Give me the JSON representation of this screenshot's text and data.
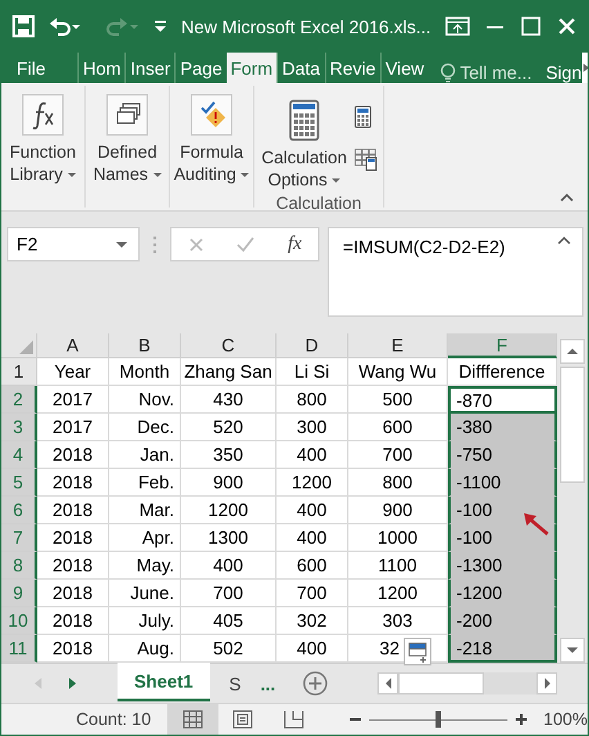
{
  "window": {
    "title": "New Microsoft Excel 2016.xls..."
  },
  "tabs": [
    {
      "label": "File",
      "selected": false
    },
    {
      "label": "Hom",
      "selected": false
    },
    {
      "label": "Inser",
      "selected": false
    },
    {
      "label": "Page",
      "selected": false
    },
    {
      "label": "Form",
      "selected": true
    },
    {
      "label": "Data",
      "selected": false
    },
    {
      "label": "Revie",
      "selected": false
    },
    {
      "label": "View",
      "selected": false
    }
  ],
  "tell_me": "Tell me...",
  "sign_in": "Sign",
  "ribbon": {
    "groups": [
      {
        "buttons": [
          {
            "kind": "fx",
            "label": "Function Library"
          }
        ]
      },
      {
        "buttons": [
          {
            "kind": "names",
            "label": "Defined Names"
          }
        ]
      },
      {
        "buttons": [
          {
            "kind": "audit",
            "label": "Formula Auditing"
          }
        ]
      },
      {
        "label": "Calculation",
        "buttons": [
          {
            "kind": "calc",
            "label": "Calculation Options"
          }
        ]
      }
    ]
  },
  "formula_bar": {
    "name_box": "F2",
    "fx": "fx",
    "formula": "=IMSUM(C2-D2-E2)"
  },
  "sheet": {
    "columns": [
      {
        "label": "A",
        "selected": false
      },
      {
        "label": "B",
        "selected": false
      },
      {
        "label": "C",
        "selected": false
      },
      {
        "label": "D",
        "selected": false
      },
      {
        "label": "E",
        "selected": false
      },
      {
        "label": "F",
        "selected": true
      }
    ],
    "rows": [
      {
        "number": "1",
        "selected": false,
        "cells": [
          "Year",
          "Month",
          "Zhang San",
          "Li Si",
          "Wang Wu",
          "Diffference"
        ]
      },
      {
        "number": "2",
        "selected": true,
        "cells": [
          "2017",
          "Nov.",
          "430",
          "800",
          "500",
          "-870"
        ]
      },
      {
        "number": "3",
        "selected": true,
        "cells": [
          "2017",
          "Dec.",
          "520",
          "300",
          "600",
          "-380"
        ]
      },
      {
        "number": "4",
        "selected": true,
        "cells": [
          "2018",
          "Jan.",
          "350",
          "400",
          "700",
          "-750"
        ]
      },
      {
        "number": "5",
        "selected": true,
        "cells": [
          "2018",
          "Feb.",
          "900",
          "1200",
          "800",
          "-1100"
        ]
      },
      {
        "number": "6",
        "selected": true,
        "cells": [
          "2018",
          "Mar.",
          "1200",
          "400",
          "900",
          "-100"
        ]
      },
      {
        "number": "7",
        "selected": true,
        "cells": [
          "2018",
          "Apr.",
          "1300",
          "400",
          "1000",
          "-100"
        ]
      },
      {
        "number": "8",
        "selected": true,
        "cells": [
          "2018",
          "May.",
          "400",
          "600",
          "1100",
          "-1300"
        ]
      },
      {
        "number": "9",
        "selected": true,
        "cells": [
          "2018",
          "June.",
          "700",
          "700",
          "1200",
          "-1200"
        ]
      },
      {
        "number": "10",
        "selected": true,
        "cells": [
          "2018",
          "July.",
          "405",
          "302",
          "303",
          "-200"
        ]
      },
      {
        "number": "11",
        "selected": true,
        "cells": [
          "2018",
          "Aug.",
          "502",
          "400",
          "32",
          "-218"
        ]
      }
    ]
  },
  "sheet_tabs": [
    {
      "label": "Sheet1",
      "selected": true
    },
    {
      "label": "S",
      "selected": false
    }
  ],
  "more_sheets": "...",
  "status_bar": {
    "text": "Count: 10",
    "views": [
      {
        "kind": "normal",
        "selected": true
      },
      {
        "kind": "layout",
        "selected": false
      },
      {
        "kind": "break",
        "selected": false
      }
    ],
    "zoom": {
      "level": 0.5,
      "label": "100%"
    }
  }
}
